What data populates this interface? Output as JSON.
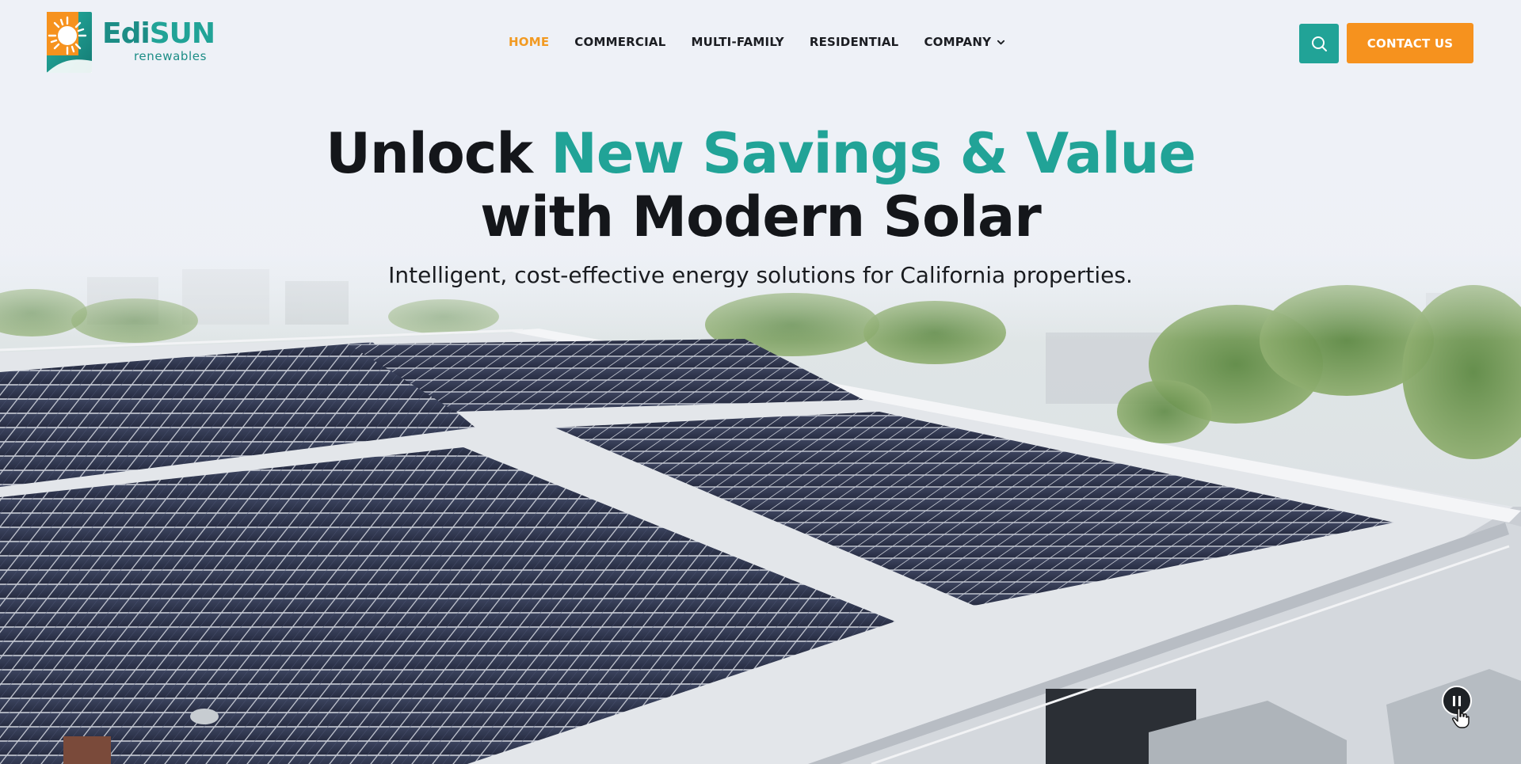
{
  "brand": {
    "name_part1": "Edi",
    "name_part2": "SUN",
    "tagline": "renewables"
  },
  "nav": {
    "items": [
      {
        "label": "HOME",
        "active": true
      },
      {
        "label": "COMMERCIAL",
        "active": false
      },
      {
        "label": "MULTI-FAMILY",
        "active": false
      },
      {
        "label": "RESIDENTIAL",
        "active": false
      },
      {
        "label": "COMPANY",
        "active": false,
        "has_dropdown": true
      }
    ]
  },
  "header": {
    "search_icon": "search-icon",
    "contact_label": "CONTACT US"
  },
  "hero": {
    "headline_part1": "Unlock ",
    "headline_highlight": "New Savings & Value",
    "headline_line2": "with Modern Solar",
    "subheadline": "Intelligent, cost-effective energy solutions for California properties.",
    "video_control_icon": "pause-icon"
  },
  "colors": {
    "accent_teal": "#21a397",
    "accent_orange": "#f6921e",
    "nav_active": "#f29a22",
    "text_dark": "#14161a"
  }
}
